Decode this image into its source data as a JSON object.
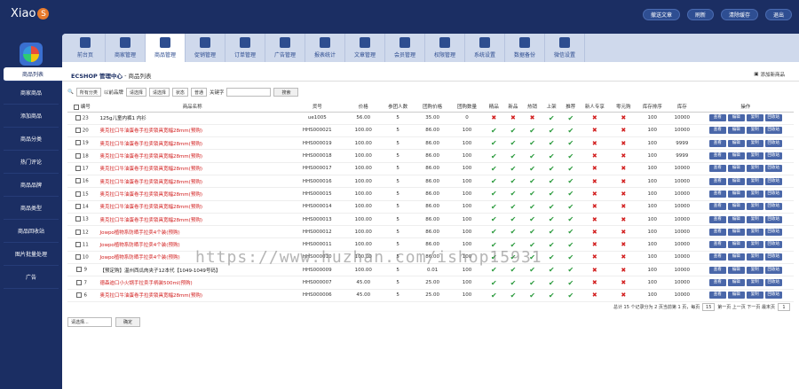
{
  "app": {
    "logo_text": "Xiao",
    "logo_badge": "S"
  },
  "topbar": {
    "buttons": [
      "撤送文章",
      "刷新",
      "清除缓存",
      "退出"
    ]
  },
  "sidebar": {
    "items": [
      "商品列表",
      "商家商品",
      "添加商品",
      "商品分类",
      "热门评论",
      "商品品牌",
      "商品类型",
      "商品回收站",
      "图片批量处理",
      "广告"
    ]
  },
  "tabs": [
    "前台页",
    "商家管理",
    "商品管理",
    "促销管理",
    "订单管理",
    "广告管理",
    "报表统计",
    "文章管理",
    "会员管理",
    "权限管理",
    "系统设置",
    "数据备份",
    "微信设置"
  ],
  "breadcrumb": {
    "root": "ECSHOP 管理中心",
    "title": "商品列表",
    "add": "添加新商品"
  },
  "filter": {
    "all_categories": "所有分类",
    "brand_label": "以前品牌",
    "brand": "请选择",
    "promo": "请选择",
    "status": "状态",
    "type": "普通",
    "keyword_label": "关键字",
    "search_btn": "搜索"
  },
  "table": {
    "headers": [
      "编号",
      "商品名称",
      "货号",
      "价格",
      "参团人数",
      "团购价格",
      "团购数量",
      "精品",
      "新品",
      "热销",
      "上架",
      "推荐",
      "新人专享",
      "零元购",
      "库存排序",
      "库存",
      "操作"
    ],
    "actions": [
      "查看",
      "编辑",
      "复制",
      "回收站"
    ],
    "rows": [
      {
        "id": "23",
        "name": "125g儿童内裤1 内衫",
        "color": "dark",
        "sn": "ue1005",
        "price": "56.00",
        "group": "5",
        "gprice": "35.00",
        "gnum": "0",
        "flags": [
          "x",
          "x",
          "x",
          "y",
          "y",
          "x",
          "x"
        ],
        "sort": "100",
        "stock": "10000"
      },
      {
        "id": "20",
        "name": "奥克拉口牛油蛋卷手拉卖锁具宽幅28mm(预购)",
        "color": "red",
        "sn": "HHS000021",
        "price": "100.00",
        "group": "5",
        "gprice": "86.00",
        "gnum": "100",
        "flags": [
          "y",
          "y",
          "y",
          "y",
          "y",
          "x",
          "x"
        ],
        "sort": "100",
        "stock": "10000"
      },
      {
        "id": "19",
        "name": "奥克拉口牛油蛋卷手拉卖锁具宽幅28mm(预购)",
        "color": "red",
        "sn": "HHS000019",
        "price": "100.00",
        "group": "5",
        "gprice": "86.00",
        "gnum": "100",
        "flags": [
          "y",
          "y",
          "y",
          "y",
          "y",
          "x",
          "x"
        ],
        "sort": "100",
        "stock": "9999"
      },
      {
        "id": "18",
        "name": "奥克拉口牛油蛋卷手拉卖锁具宽幅28mm(预购)",
        "color": "red",
        "sn": "HHS000018",
        "price": "100.00",
        "group": "5",
        "gprice": "86.00",
        "gnum": "100",
        "flags": [
          "y",
          "y",
          "y",
          "y",
          "y",
          "x",
          "x"
        ],
        "sort": "100",
        "stock": "9999"
      },
      {
        "id": "17",
        "name": "奥克拉口牛油蛋卷手拉卖锁具宽幅28mm(预购)",
        "color": "red",
        "sn": "HHS000017",
        "price": "100.00",
        "group": "5",
        "gprice": "86.00",
        "gnum": "100",
        "flags": [
          "y",
          "y",
          "y",
          "y",
          "y",
          "x",
          "x"
        ],
        "sort": "100",
        "stock": "10000"
      },
      {
        "id": "16",
        "name": "奥克拉口牛油蛋卷手拉卖锁具宽幅28mm(预购)",
        "color": "red",
        "sn": "HHS000016",
        "price": "100.00",
        "group": "5",
        "gprice": "86.00",
        "gnum": "100",
        "flags": [
          "y",
          "y",
          "y",
          "y",
          "y",
          "x",
          "x"
        ],
        "sort": "100",
        "stock": "10000"
      },
      {
        "id": "15",
        "name": "奥克拉口牛油蛋卷手拉卖锁具宽幅28mm(预购)",
        "color": "red",
        "sn": "HHS000015",
        "price": "100.00",
        "group": "5",
        "gprice": "86.00",
        "gnum": "100",
        "flags": [
          "y",
          "y",
          "y",
          "y",
          "y",
          "x",
          "x"
        ],
        "sort": "100",
        "stock": "10000"
      },
      {
        "id": "14",
        "name": "奥克拉口牛油蛋卷手拉卖锁具宽幅28mm(预购)",
        "color": "red",
        "sn": "HHS000014",
        "price": "100.00",
        "group": "5",
        "gprice": "86.00",
        "gnum": "100",
        "flags": [
          "y",
          "y",
          "y",
          "y",
          "y",
          "x",
          "x"
        ],
        "sort": "100",
        "stock": "10000"
      },
      {
        "id": "13",
        "name": "奥克拉口牛油蛋卷手拉卖锁具宽幅28mm(预购)",
        "color": "red",
        "sn": "HHS000013",
        "price": "100.00",
        "group": "5",
        "gprice": "86.00",
        "gnum": "100",
        "flags": [
          "y",
          "y",
          "y",
          "y",
          "y",
          "x",
          "x"
        ],
        "sort": "100",
        "stock": "10000"
      },
      {
        "id": "12",
        "name": "Jowpo植物系防晒手拉卖4个装(预购)",
        "color": "red",
        "sn": "HHS000012",
        "price": "100.00",
        "group": "5",
        "gprice": "86.00",
        "gnum": "100",
        "flags": [
          "y",
          "y",
          "y",
          "y",
          "y",
          "x",
          "x"
        ],
        "sort": "100",
        "stock": "10000"
      },
      {
        "id": "11",
        "name": "Jowpo植物系防晒手拉卖4个装(预购)",
        "color": "red",
        "sn": "HHS000011",
        "price": "100.00",
        "group": "5",
        "gprice": "86.00",
        "gnum": "100",
        "flags": [
          "y",
          "y",
          "y",
          "y",
          "y",
          "x",
          "x"
        ],
        "sort": "100",
        "stock": "10000"
      },
      {
        "id": "10",
        "name": "Jowpo植物系防晒手拉卖4个装(预购)",
        "color": "red",
        "sn": "HHS000010",
        "price": "100.00",
        "group": "5",
        "gprice": "86.00",
        "gnum": "100",
        "flags": [
          "y",
          "y",
          "y",
          "y",
          "y",
          "x",
          "x"
        ],
        "sort": "100",
        "stock": "10000"
      },
      {
        "id": "9",
        "name": "【预定购】温州西瓜肉夹子12本代【1049-1049号码】",
        "color": "dark",
        "sn": "HHS000009",
        "price": "100.00",
        "group": "5",
        "gprice": "0.01",
        "gnum": "100",
        "flags": [
          "y",
          "y",
          "y",
          "y",
          "y",
          "x",
          "x"
        ],
        "sort": "100",
        "stock": "10000"
      },
      {
        "id": "7",
        "name": "德森迪口小火锅手拉卖手柄装500ml(预购)",
        "color": "red",
        "sn": "HHS000007",
        "price": "45.00",
        "group": "5",
        "gprice": "25.00",
        "gnum": "100",
        "flags": [
          "y",
          "y",
          "y",
          "y",
          "y",
          "x",
          "x"
        ],
        "sort": "100",
        "stock": "10000"
      },
      {
        "id": "6",
        "name": "奥克拉口牛油蛋卷手拉卖锁具宽幅28mm(预购)",
        "color": "red",
        "sn": "HHS000006",
        "price": "45.00",
        "group": "5",
        "gprice": "25.00",
        "gnum": "100",
        "flags": [
          "y",
          "y",
          "y",
          "y",
          "y",
          "x",
          "x"
        ],
        "sort": "100",
        "stock": "10000"
      }
    ]
  },
  "pager": {
    "summary": "总计 15 个记录分为 2 页当前第 1 页，每页",
    "per_page": "15",
    "nav": "第一页 上一页 下一页 最末页",
    "page_select": "1"
  },
  "bottom": {
    "select": "请选择...",
    "confirm": "确定"
  },
  "watermark": "https://www.huzhan.com/ishop15931",
  "colors": {
    "nav_bg": "#1b2e63",
    "check": "#2a9a3c",
    "cross": "#d21e1e",
    "action_btn": "#4a67a9"
  }
}
